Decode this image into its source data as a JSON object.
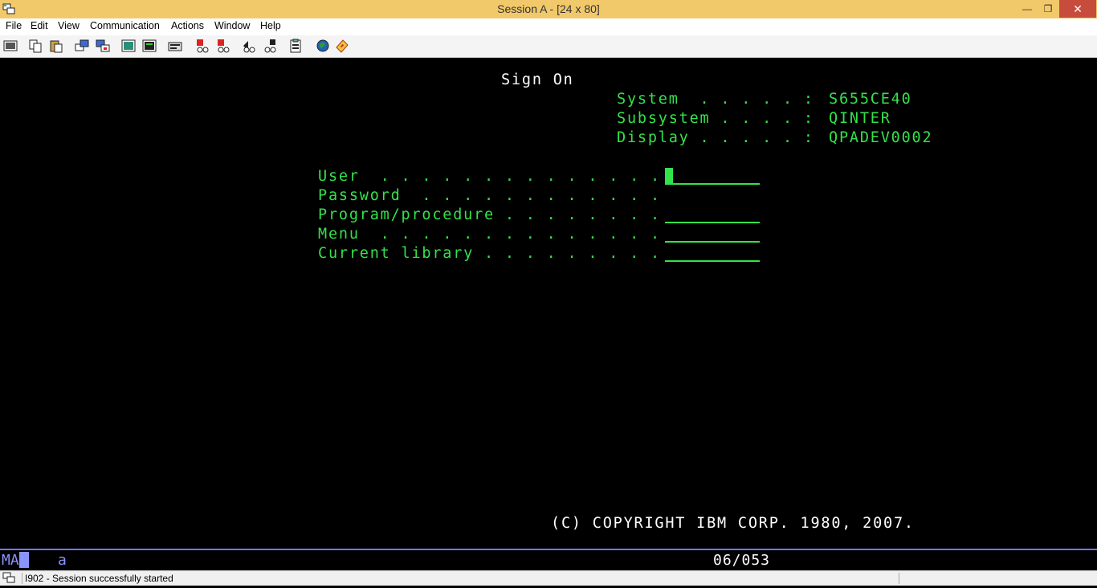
{
  "window": {
    "title": "Session A - [24 x 80]",
    "minimize": "—",
    "maximize": "❐",
    "close": "✕"
  },
  "menu": [
    "File",
    "Edit",
    "View",
    "Communication",
    "Actions",
    "Window",
    "Help"
  ],
  "toolbar": {
    "icons": [
      "print-screen-icon",
      "copy-icon",
      "paste-icon",
      "send-file-icon",
      "receive-file-icon",
      "display-keypad-icon",
      "macro-icon",
      "record-macro-icon",
      "stop-macro-icon",
      "play-macro-icon",
      "customize-icon",
      "support-icon",
      "clipboard-icon",
      "globe-help-icon",
      "ticket-icon"
    ]
  },
  "screen": {
    "title": "Sign On",
    "system_label": "System  . . . . . :",
    "system_value": "S655CE40",
    "subsystem_label": "Subsystem . . . . :",
    "subsystem_value": "QINTER",
    "display_label": "Display . . . . . :",
    "display_value": "QPADEV0002",
    "user_label": "User  . . . . . . . . . . . . . .",
    "password_label": "Password  . . . . . . . . . . . .",
    "program_label": "Program/procedure . . . . . . . .",
    "menu_label": "Menu  . . . . . . . . . . . . . .",
    "library_label": "Current library . . . . . . . . .",
    "copyright": "(C) COPYRIGHT IBM CORP. 1980, 2007."
  },
  "oia": {
    "mode": "MA",
    "shift": "a",
    "cursor_position": "06/053"
  },
  "status": {
    "message": "I902 - Session successfully started"
  },
  "colors": {
    "title_bar": "#f2c96a",
    "screen_text": "#33e24a",
    "oia_accent": "#8a94ff"
  }
}
